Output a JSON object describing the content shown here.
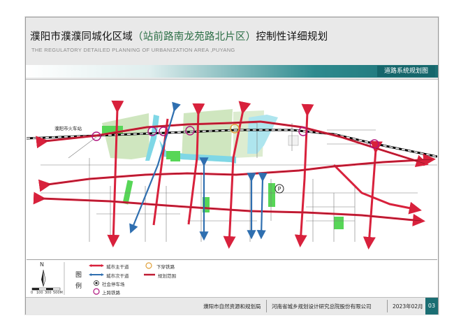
{
  "header": {
    "title_main": "濮阳市濮濮同城化区域",
    "title_highlight": "（站前路南龙苑路北片区）",
    "title_tail": "控制性详细规划",
    "subtitle": "THE REGULATORY DETAILED PLANNING OF URBANIZATION AREA ,PUYANG",
    "map_name": "道路系统规划图"
  },
  "map": {
    "station_label": "濮阳市火车站",
    "parking_symbol": "P",
    "colors": {
      "main_road": "#d8213c",
      "secondary_road": "#2f6fb0",
      "green": "#57d657",
      "light_green": "#cfe6bf",
      "water": "#7fd7e6",
      "railway": "#000000"
    }
  },
  "legend": {
    "label_cn": "图",
    "label_cn2": "例",
    "north": "N",
    "scale_ticks": [
      "0",
      "100",
      "300",
      "500M"
    ],
    "items": {
      "main_road": "城市主干道",
      "secondary_road": "城市次干道",
      "parking": "社会停车场",
      "overpass": "上跨铁路",
      "underpass": "下穿铁路",
      "boundary": "规划范围"
    }
  },
  "footer": {
    "org1": "濮阳市自然资源和规划局",
    "org2": "河南省城乡规划设计研究总院股份有限公司",
    "date": "2023年02月",
    "page": "03"
  }
}
